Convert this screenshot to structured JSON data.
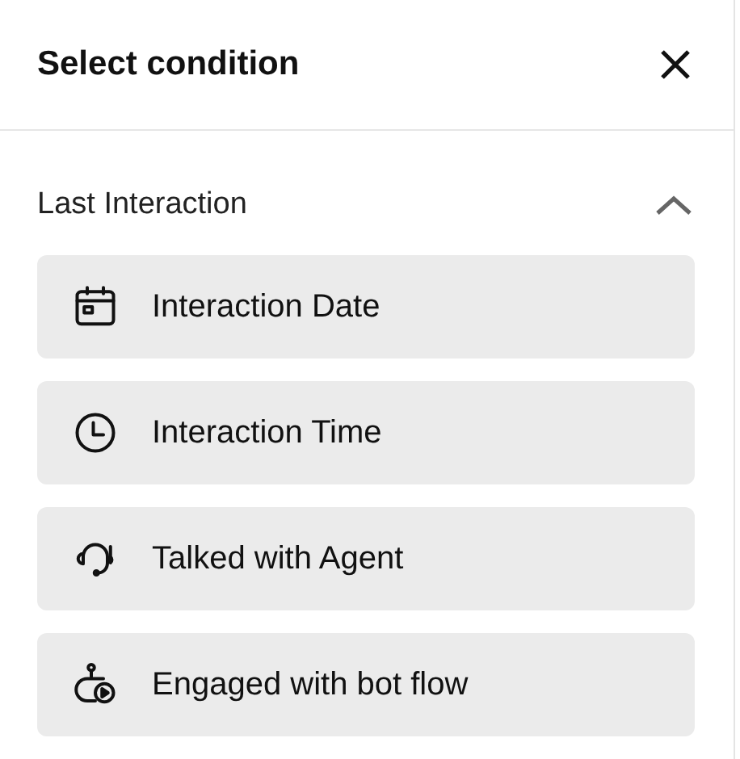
{
  "panel": {
    "title": "Select condition"
  },
  "section": {
    "label": "Last Interaction",
    "expanded": true,
    "items": [
      {
        "kind": "date",
        "label": "Interaction Date"
      },
      {
        "kind": "time",
        "label": "Interaction Time"
      },
      {
        "kind": "agent",
        "label": "Talked with Agent"
      },
      {
        "kind": "bot",
        "label": "Engaged with bot flow"
      }
    ]
  }
}
